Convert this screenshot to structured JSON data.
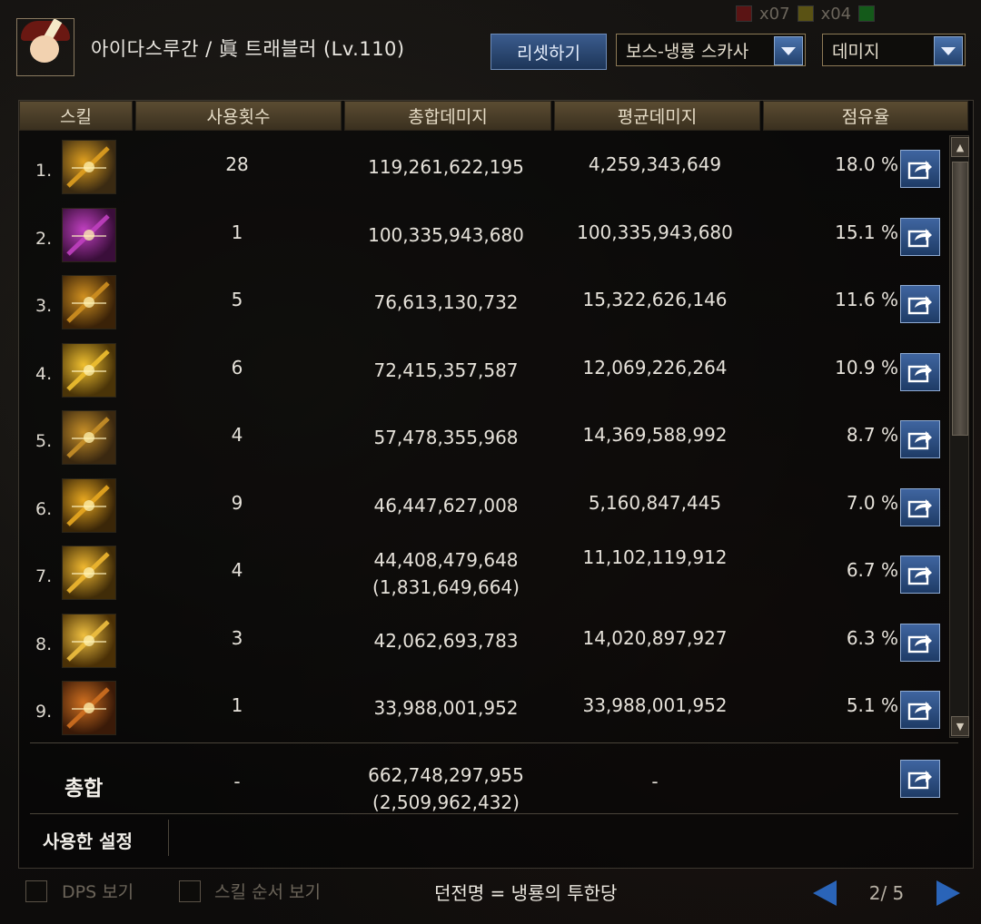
{
  "top_strip": {
    "count_a": "x07",
    "count_b": "x04"
  },
  "header": {
    "character": "아이다스루간 / 眞 트래블러 (Lv.110)",
    "reset_label": "리셋하기",
    "filter_select": "보스-냉룡 스카사",
    "metric_select": "데미지"
  },
  "table": {
    "columns": [
      "스킬",
      "사용횟수",
      "총합데미지",
      "평균데미지",
      "점유율"
    ],
    "rows": [
      {
        "rank": "1.",
        "count": "28",
        "total": "119,261,622,195",
        "total_sub": "",
        "avg": "4,259,343,649",
        "share": "18.0 %",
        "icon_colors": [
          "#3a2a12",
          "#e0a020"
        ]
      },
      {
        "rank": "2.",
        "count": "1",
        "total": "100,335,943,680",
        "total_sub": "",
        "avg": "100,335,943,680",
        "share": "15.1 %",
        "icon_colors": [
          "#3a0e3a",
          "#c040c0"
        ]
      },
      {
        "rank": "3.",
        "count": "5",
        "total": "76,613,130,732",
        "total_sub": "",
        "avg": "15,322,626,146",
        "share": "11.6 %",
        "icon_colors": [
          "#3a2208",
          "#d09020"
        ]
      },
      {
        "rank": "4.",
        "count": "6",
        "total": "72,415,357,587",
        "total_sub": "",
        "avg": "12,069,226,264",
        "share": "10.9 %",
        "icon_colors": [
          "#4a3408",
          "#f0c030"
        ]
      },
      {
        "rank": "5.",
        "count": "4",
        "total": "57,478,355,968",
        "total_sub": "",
        "avg": "14,369,588,992",
        "share": "8.7 %",
        "icon_colors": [
          "#3a2810",
          "#c89028"
        ]
      },
      {
        "rank": "6.",
        "count": "9",
        "total": "46,447,627,008",
        "total_sub": "",
        "avg": "5,160,847,445",
        "share": "7.0 %",
        "icon_colors": [
          "#3a2608",
          "#e8a820"
        ]
      },
      {
        "rank": "7.",
        "count": "4",
        "total": "44,408,479,648",
        "total_sub": "(1,831,649,664)",
        "avg": "11,102,119,912",
        "share": "6.7 %",
        "icon_colors": [
          "#402c08",
          "#f0b830"
        ]
      },
      {
        "rank": "8.",
        "count": "3",
        "total": "42,062,693,783",
        "total_sub": "",
        "avg": "14,020,897,927",
        "share": "6.3 %",
        "icon_colors": [
          "#4a3006",
          "#f0c040"
        ]
      },
      {
        "rank": "9.",
        "count": "1",
        "total": "33,988,001,952",
        "total_sub": "",
        "avg": "33,988,001,952",
        "share": "5.1 %",
        "icon_colors": [
          "#3a1a08",
          "#d07020"
        ]
      }
    ],
    "total": {
      "label": "총합",
      "count": "-",
      "total": "662,748,297,955",
      "total_sub": "(2,509,962,432)",
      "avg": "-"
    },
    "settings_label": "사용한 설정"
  },
  "footer": {
    "dps_label": "DPS 보기",
    "order_label": "스킬 순서 보기",
    "dungeon": "던전명 = 냉룡의 투한당",
    "page": "2/ 5"
  },
  "icons": {
    "share": "share-export-icon",
    "prev": "prev-page-icon",
    "next": "next-page-icon",
    "dropdown": "chevron-down-icon"
  }
}
